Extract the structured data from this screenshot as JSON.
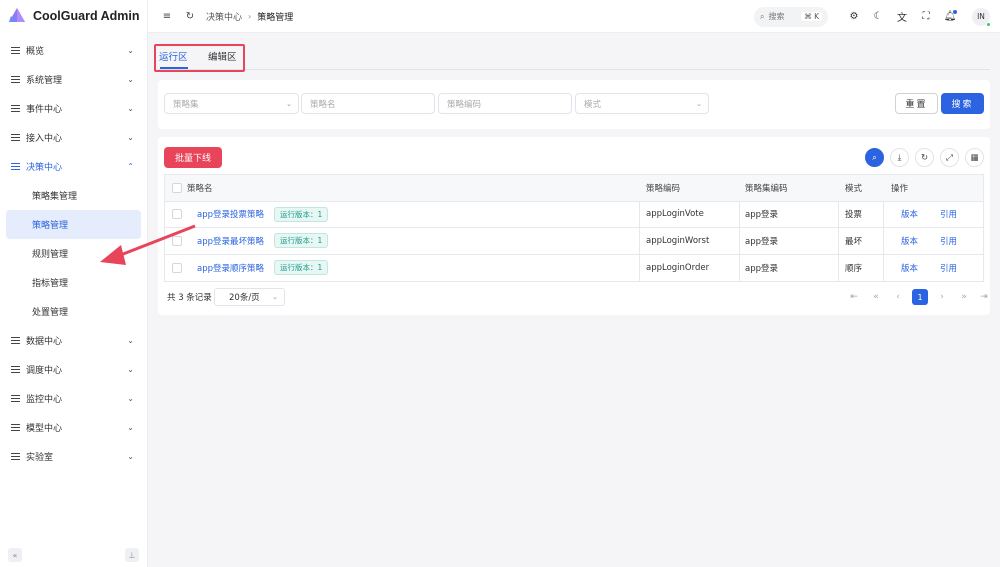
{
  "app": {
    "title": "CoolGuard Admin"
  },
  "sidebar": {
    "items": [
      {
        "label": "概览"
      },
      {
        "label": "系统管理"
      },
      {
        "label": "事件中心"
      },
      {
        "label": "接入中心"
      },
      {
        "label": "决策中心",
        "open": true
      },
      {
        "label": "数据中心"
      },
      {
        "label": "调度中心"
      },
      {
        "label": "监控中心"
      },
      {
        "label": "模型中心"
      },
      {
        "label": "实验室"
      }
    ],
    "sub_items": [
      {
        "label": "策略集管理"
      },
      {
        "label": "策略管理",
        "active": true
      },
      {
        "label": "规则管理"
      },
      {
        "label": "指标管理"
      },
      {
        "label": "处置管理"
      }
    ]
  },
  "header": {
    "breadcrumb": [
      "决策中心",
      "策略管理"
    ],
    "search": {
      "label": "搜索",
      "shortcut": "⌘ K"
    },
    "avatar": "IN"
  },
  "tabs": [
    {
      "label": "运行区",
      "active": true
    },
    {
      "label": "编辑区"
    }
  ],
  "filters": {
    "strategy_set_placeholder": "策略集",
    "strategy_name_placeholder": "策略名",
    "strategy_code_placeholder": "策略编码",
    "mode_placeholder": "模式",
    "reset_label": "重置",
    "search_label": "搜索"
  },
  "toolbar": {
    "batch_offline_label": "批量下线"
  },
  "table": {
    "columns": [
      "策略名",
      "策略编码",
      "策略集编码",
      "模式",
      "操作"
    ],
    "rows": [
      {
        "name": "app登录投票策略",
        "tag": "运行版本：1",
        "code": "appLoginVote",
        "set_code": "app登录",
        "mode": "投票",
        "action_version": "版本",
        "action_ref": "引用"
      },
      {
        "name": "app登录最坏策略",
        "tag": "运行版本：1",
        "code": "appLoginWorst",
        "set_code": "app登录",
        "mode": "最坏",
        "action_version": "版本",
        "action_ref": "引用"
      },
      {
        "name": "app登录顺序策略",
        "tag": "运行版本：1",
        "code": "appLoginOrder",
        "set_code": "app登录",
        "mode": "顺序",
        "action_version": "版本",
        "action_ref": "引用"
      }
    ]
  },
  "pagination": {
    "total_text": "共 3 条记录",
    "page_size": "20条/页",
    "current_page": "1"
  },
  "colors": {
    "accent": "#2b63e0",
    "danger": "#e8445a",
    "annotation": "#e8445a"
  }
}
